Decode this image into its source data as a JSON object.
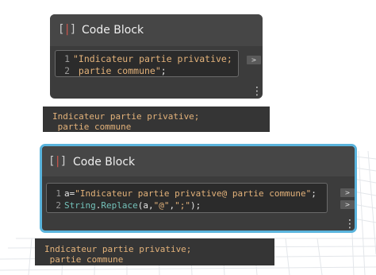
{
  "node1": {
    "title": "Code Block",
    "icon": "code-block-bracket-icon",
    "lines": [
      {
        "num": "1",
        "segments": [
          {
            "cls": "str",
            "text": "\"Indicateur partie privative;"
          }
        ]
      },
      {
        "num": "2",
        "segments": [
          {
            "cls": "str",
            "text": " partie commune\""
          },
          {
            "cls": "plain",
            "text": ";"
          }
        ]
      }
    ],
    "output_port": ">",
    "menu": "⋮",
    "preview": "Indicateur partie privative;\n partie commune"
  },
  "node2": {
    "title": "Code Block",
    "icon": "code-block-bracket-icon",
    "selected": true,
    "lines": [
      {
        "num": "1",
        "segments": [
          {
            "cls": "plain",
            "text": "a="
          },
          {
            "cls": "str",
            "text": "\"Indicateur partie privative@ partie commune\""
          },
          {
            "cls": "plain",
            "text": ";"
          }
        ]
      },
      {
        "num": "2",
        "segments": [
          {
            "cls": "func",
            "text": "String"
          },
          {
            "cls": "plain",
            "text": "."
          },
          {
            "cls": "func",
            "text": "Replace"
          },
          {
            "cls": "plain",
            "text": "(a,"
          },
          {
            "cls": "str",
            "text": "\"@\""
          },
          {
            "cls": "plain",
            "text": ","
          },
          {
            "cls": "str",
            "text": "\";\""
          },
          {
            "cls": "plain",
            "text": ");"
          }
        ]
      }
    ],
    "output_ports": [
      ">",
      ">"
    ],
    "menu": "⋮",
    "preview": "Indicateur partie privative;\n partie commune"
  },
  "colors": {
    "node_body": "#3c3c3c",
    "selection_border": "#5ab4dd",
    "string": "#e3b27a",
    "function": "#73c1b9",
    "icon_accent": "#d2574d"
  }
}
